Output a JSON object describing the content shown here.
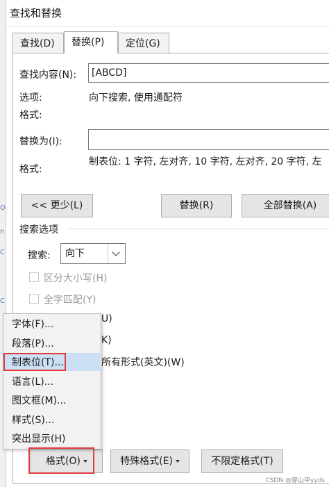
{
  "window": {
    "title": "查找和替换"
  },
  "tabs": [
    {
      "label": "查找(D)"
    },
    {
      "label": "替换(P)"
    },
    {
      "label": "定位(G)"
    }
  ],
  "find": {
    "label": "查找内容(N):",
    "value": "[ABCD]",
    "options_label": "选项:",
    "options_value": "向下搜索, 使用通配符",
    "format_label": "格式:"
  },
  "replace": {
    "label": "替换为(I):",
    "value": "",
    "format_label": "格式:",
    "format_value": "制表位: 1 字符, 左对齐, 10 字符, 左对齐, 20 字符, 左"
  },
  "buttons": {
    "less": "<< 更少(L)",
    "replace": "替换(R)",
    "replace_all": "全部替换(A)",
    "format": "格式(O)",
    "special": "特殊格式(E)",
    "no_format": "不限定格式(T)"
  },
  "search_options": {
    "title": "搜索选项",
    "search_label": "搜索:",
    "search_value": "向下",
    "match_case": "区分大小写(H)",
    "whole_word": "全字匹配(Y)",
    "partial_1": "U)",
    "partial_2": "K)",
    "partial_3": "所有形式(英文)(W)"
  },
  "format_menu": {
    "items": [
      {
        "label": "字体(F)..."
      },
      {
        "label": "段落(P)..."
      },
      {
        "label": "制表位(T)..."
      },
      {
        "label": "语言(L)..."
      },
      {
        "label": "图文框(M)..."
      },
      {
        "label": "样式(S)..."
      },
      {
        "label": "突出显示(H)"
      }
    ],
    "highlighted_index": 2
  },
  "left_strip": [
    "O",
    "n",
    "C",
    "C"
  ],
  "watermark": "CSDN @穿山甲yyds",
  "colors": {
    "highlight": "#cce0f5",
    "annotation": "#e03c3c",
    "button": "#e5e5e5"
  }
}
